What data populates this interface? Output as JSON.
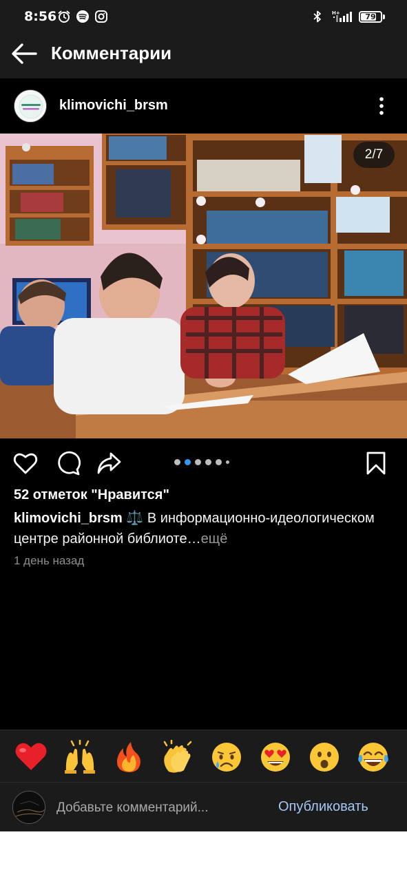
{
  "status_bar": {
    "time": "8:56",
    "battery_percent": 79,
    "battery_text": "79",
    "icons": [
      "alarm-icon",
      "spotify-icon",
      "instagram-icon",
      "bluetooth-icon",
      "signal-icon",
      "battery-icon"
    ]
  },
  "header": {
    "title": "Комментарии",
    "back_icon": "arrow-left-icon"
  },
  "post": {
    "author": "klimovichi_brsm",
    "more_icon": "more-vertical-icon",
    "photo_alt": "Three students sitting at a desk in a library reading papers",
    "counter": "2/7",
    "carousel": {
      "count": 6,
      "active": 2
    },
    "likes": "52 отметок \"Нравится\"",
    "caption": {
      "author": "klimovichi_brsm",
      "emoji": "⚖️",
      "text": "В информационно-идеологическом центре районной библиоте",
      "ellipsis": "…",
      "more": "ещё"
    },
    "time_ago": "1 день назад",
    "actions": [
      "heart-icon",
      "comment-icon",
      "share-icon",
      "bookmark-icon"
    ]
  },
  "reactions": [
    {
      "name": "red-heart",
      "glyph": "❤️"
    },
    {
      "name": "raising-hands",
      "glyph": "🙌"
    },
    {
      "name": "fire",
      "glyph": "🔥"
    },
    {
      "name": "clapping-hands",
      "glyph": "👏"
    },
    {
      "name": "crying-face",
      "glyph": "😢"
    },
    {
      "name": "heart-eyes",
      "glyph": "😍"
    },
    {
      "name": "surprised-face",
      "glyph": "😮"
    },
    {
      "name": "tears-of-joy",
      "glyph": "😂"
    }
  ],
  "comment_bar": {
    "placeholder": "Добавьте комментарий...",
    "publish_label": "Опубликовать"
  },
  "colors": {
    "background": "#000000",
    "bar": "#1b1b1b",
    "publish": "#a5c8f5",
    "muted": "#8e8e8e"
  }
}
